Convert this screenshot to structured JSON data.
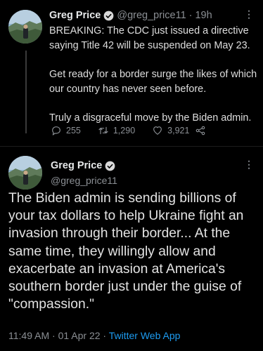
{
  "tweet1": {
    "author_name": "Greg Price",
    "handle": "@greg_price11",
    "separator": "·",
    "time": "19h",
    "paragraphs": [
      "BREAKING: The CDC just issued a directive saying Title 42 will be suspended on May 23.",
      "Get ready for a border surge the likes of which our country has never seen before.",
      "Truly a disgraceful move by the Biden admin."
    ],
    "replies": "255",
    "retweets": "1,290",
    "likes": "3,921"
  },
  "tweet2": {
    "author_name": "Greg Price",
    "handle": "@greg_price11",
    "text": "The Biden admin is sending billions of your tax dollars to help Ukraine fight an invasion through their border... At the same time, they willingly allow and exacerbate an invasion at America's southern border just under the guise of \"compassion.\"",
    "time": "11:49 AM",
    "date": "01 Apr 22",
    "separator": "·",
    "source": "Twitter Web App"
  },
  "icons": {
    "verified": "verified-badge-icon",
    "reply": "reply-icon",
    "retweet": "retweet-icon",
    "like": "heart-icon",
    "share": "share-icon",
    "more": "more-options-icon"
  },
  "colors": {
    "background": "#000000",
    "link": "#1d9bf0",
    "muted": "#8b8f94"
  }
}
